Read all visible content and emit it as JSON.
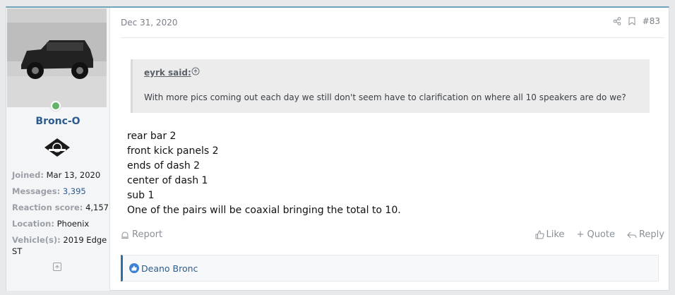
{
  "post": {
    "date": "Dec 31, 2020",
    "number": "#83",
    "author": {
      "username": "Bronc-O",
      "fields": [
        {
          "label": "Joined:",
          "value": "Mar 13, 2020"
        },
        {
          "label": "Messages:",
          "value": "3,395"
        },
        {
          "label": "Reaction score:",
          "value": "4,157"
        },
        {
          "label": "Location:",
          "value": "Phoenix"
        },
        {
          "label": "Vehicle(s):",
          "value": "2019 Edge ST"
        }
      ]
    },
    "quote": {
      "author": "eyrk said:",
      "text": "With more pics coming out each day we still don't seem have to clarification on where all 10 speakers are do we?"
    },
    "message_lines": [
      "rear bar 2",
      "front kick panels 2",
      "ends of dash 2",
      "center of dash 1",
      "sub 1",
      "One of the pairs will be coaxial bringing the total to 10."
    ],
    "actions": {
      "report": "Report",
      "like": "Like",
      "quote": "+ Quote",
      "reply": "Reply"
    },
    "reactions": {
      "names": "Deano Bronc"
    },
    "icons": [
      "share-icon",
      "bookmark-icon",
      "up-arrow-icon",
      "report-icon",
      "like-icon",
      "reply-icon",
      "expand-icon"
    ],
    "colors": {
      "link": "#2d5c8c",
      "accent": "#2f6ea3",
      "online": "#63b36a"
    }
  }
}
